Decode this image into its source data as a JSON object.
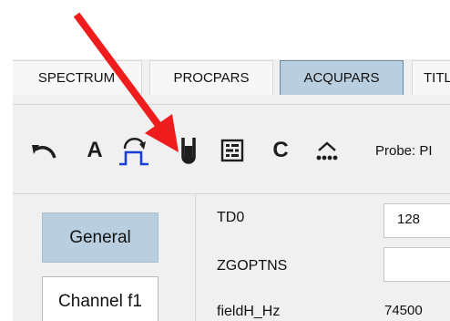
{
  "tabs": [
    {
      "label": "SPECTRUM",
      "active": false
    },
    {
      "label": "PROCPARS",
      "active": false
    },
    {
      "label": "ACQUPARS",
      "active": true
    },
    {
      "label": "TITLE",
      "active": false
    }
  ],
  "toolbar": {
    "buttons": [
      {
        "icon": "undo-arrow-icon"
      },
      {
        "label": "A",
        "icon": "letter-a-icon"
      },
      {
        "icon": "pulse-program-icon"
      },
      {
        "icon": "probe-icon"
      },
      {
        "icon": "parameter-table-icon"
      },
      {
        "label": "C",
        "icon": "letter-c-icon"
      },
      {
        "icon": "dots-triangle-icon"
      }
    ],
    "probe_label": "Probe: PI"
  },
  "nav": {
    "items": [
      {
        "label": "General",
        "selected": true
      },
      {
        "label": "Channel f1",
        "selected": false
      }
    ]
  },
  "params": [
    {
      "name": "TD0",
      "value": "128",
      "type": "input"
    },
    {
      "name": "ZGOPTNS",
      "value": "",
      "type": "input"
    },
    {
      "name": "fieldH_Hz",
      "value": "74500",
      "type": "text"
    }
  ],
  "colors": {
    "active_tab": "#b9cfe0",
    "selected_nav": "#b9cfe0",
    "pulse_icon_blue": "#1a3fd6",
    "annotation_arrow": "#ee1c1c"
  }
}
